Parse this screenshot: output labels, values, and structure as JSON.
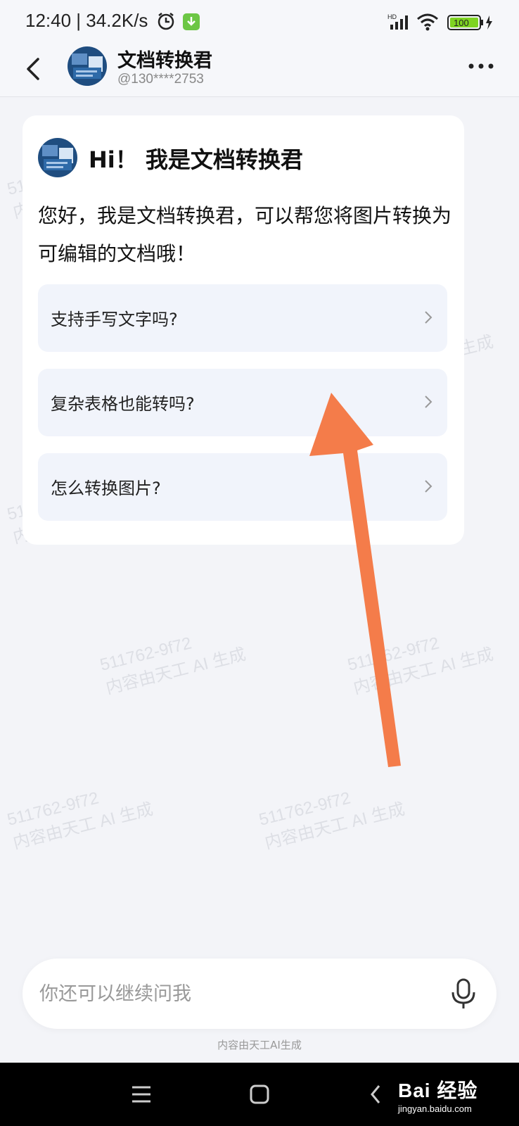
{
  "status_bar": {
    "time": "12:40 | 34.2K/s",
    "signal_label": "HD",
    "battery_level": "100",
    "battery_color": "#7ed321"
  },
  "header": {
    "title": "文档转换君",
    "subtitle": "@130****2753"
  },
  "watermark": {
    "code": "511762-9f72",
    "text": "内容由天工 AI 生成"
  },
  "card": {
    "greeting": "Hi！ 我是文档转换君",
    "intro": "您好，我是文档转换君，可以帮您将图片转换为可编辑的文档哦！",
    "suggestions": [
      {
        "label": "支持手写文字吗?"
      },
      {
        "label": "复杂表格也能转吗?"
      },
      {
        "label": "怎么转换图片?"
      }
    ]
  },
  "input": {
    "placeholder": "你还可以继续问我"
  },
  "footer_note": "内容由天工AI生成",
  "brand": {
    "logo": "Bai 经验",
    "url": "jingyan.baidu.com"
  },
  "colors": {
    "background": "#f3f4f8",
    "card": "#ffffff",
    "suggestion_bg": "#f1f4fb",
    "arrow": "#f47c4a"
  }
}
